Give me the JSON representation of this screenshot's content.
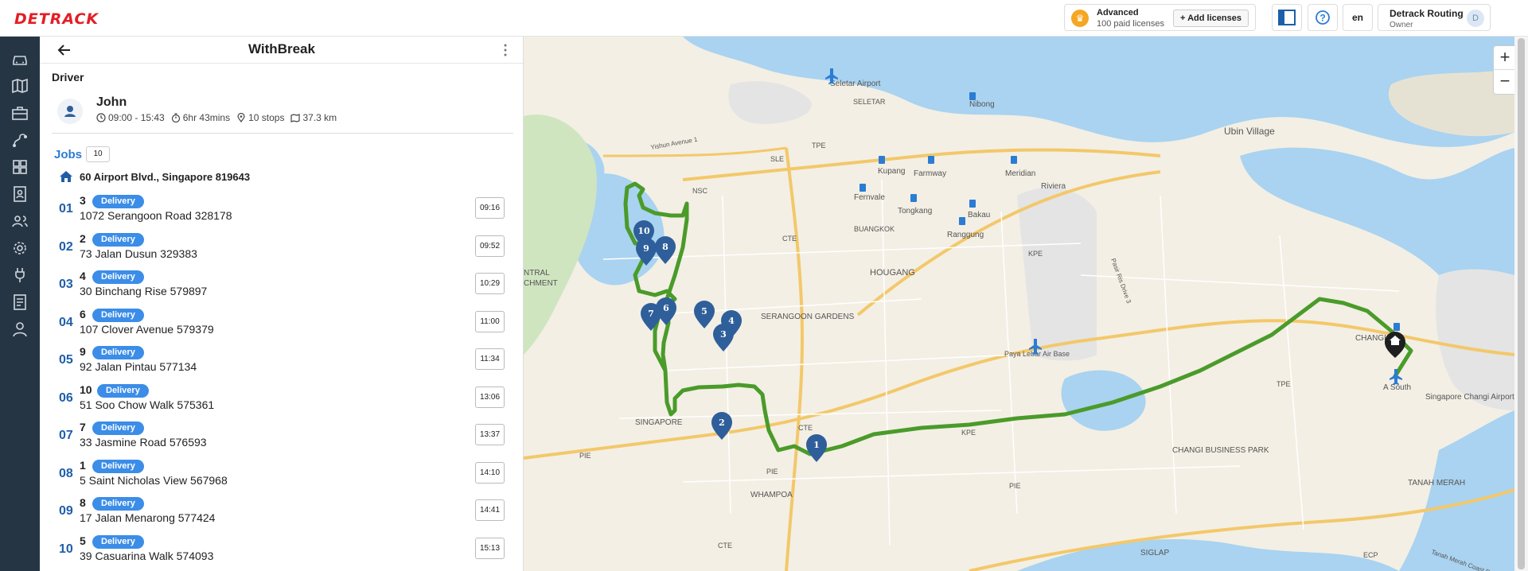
{
  "brand": {
    "logo_text": "DETRACK"
  },
  "license": {
    "plan": "Advanced",
    "count_text": "100 paid licenses",
    "add_label": "+ Add licenses"
  },
  "header": {
    "lang": "en",
    "account_name": "Detrack Routing",
    "account_role": "Owner",
    "avatar_initial": "D"
  },
  "panel": {
    "title": "WithBreak",
    "driver_label": "Driver",
    "driver_name": "John",
    "shift": "09:00 - 15:43",
    "duration": "6hr 43mins",
    "stops": "10 stops",
    "distance": "37.3 km",
    "jobs_label": "Jobs",
    "jobs_count": "10",
    "depot_address": "60 Airport Blvd., Singapore 819643",
    "stops_list": [
      {
        "seq": "01",
        "id": "3",
        "type": "Delivery",
        "address": "1072 Serangoon Road 328178",
        "time": "09:16"
      },
      {
        "seq": "02",
        "id": "2",
        "type": "Delivery",
        "address": "73 Jalan Dusun 329383",
        "time": "09:52"
      },
      {
        "seq": "03",
        "id": "4",
        "type": "Delivery",
        "address": "30 Binchang Rise 579897",
        "time": "10:29"
      },
      {
        "seq": "04",
        "id": "6",
        "type": "Delivery",
        "address": "107 Clover Avenue 579379",
        "time": "11:00"
      },
      {
        "seq": "05",
        "id": "9",
        "type": "Delivery",
        "address": "92 Jalan Pintau 577134",
        "time": "11:34"
      },
      {
        "seq": "06",
        "id": "10",
        "type": "Delivery",
        "address": "51 Soo Chow Walk 575361",
        "time": "13:06"
      },
      {
        "seq": "07",
        "id": "7",
        "type": "Delivery",
        "address": "33 Jasmine Road 576593",
        "time": "13:37"
      },
      {
        "seq": "08",
        "id": "1",
        "type": "Delivery",
        "address": "5 Saint Nicholas View 567968",
        "time": "14:10"
      },
      {
        "seq": "09",
        "id": "8",
        "type": "Delivery",
        "address": "17 Jalan Menarong 577424",
        "time": "14:41"
      },
      {
        "seq": "10",
        "id": "5",
        "type": "Delivery",
        "address": "39 Casuarina Walk 574093",
        "time": "15:13"
      }
    ]
  },
  "map": {
    "zoom_in": "+",
    "zoom_out": "−",
    "labels": {
      "seletar_airport": "Seletar Airport",
      "seletar": "SELETAR",
      "nibong": "Nibong",
      "ubin_village": "Ubin Village",
      "yishun_ave1": "Yishun Avenue 1",
      "sle": "SLE",
      "tpe": "TPE",
      "nsc": "NSC",
      "cte1": "CTE",
      "cte2": "CTE",
      "cte3": "CTE",
      "kupang": "Kupang",
      "farmway": "Farmway",
      "meridian": "Meridian",
      "riviera": "Riviera",
      "fernvale": "Fernvale",
      "tongkang": "Tongkang",
      "bakau": "Bakau",
      "buangkok": "BUANGKOK",
      "rangoon": "Ranggung",
      "hougang": "HOUGANG",
      "kpe1": "KPE",
      "kpe2": "KPE",
      "pasir_ris": "Pasir Ris Drive 3",
      "ntral": "NTRAL",
      "chment": "CHMENT",
      "serangoon_gardens": "SERANGOON GARDENS",
      "paya_lebar": "Paya Lebar Air Base",
      "tpe2": "TPE",
      "changi": "CHANGI",
      "a_south": "A South",
      "changi_airport": "Singapore Changi Airport",
      "singapore": "SINGAPORE",
      "pie1": "PIE",
      "pie2": "PIE",
      "pie3": "PIE",
      "whampoa": "WHAMPOA",
      "changi_bp": "CHANGI BUSINESS PARK",
      "siglap": "SIGLAP",
      "tanah_merah": "TANAH MERAH",
      "ecp": "ECP",
      "tanah_coast": "Tanah Merah Coast Road",
      "cte4": "CTE"
    },
    "markers": [
      "10",
      "9",
      "8",
      "7",
      "6",
      "5",
      "4",
      "3",
      "2",
      "1"
    ]
  },
  "colors": {
    "accent": "#2b7cd3",
    "route": "#4a9b2a",
    "sidebar": "#263544",
    "badge": "#3b8de8",
    "marker": "#2f5f9a"
  }
}
